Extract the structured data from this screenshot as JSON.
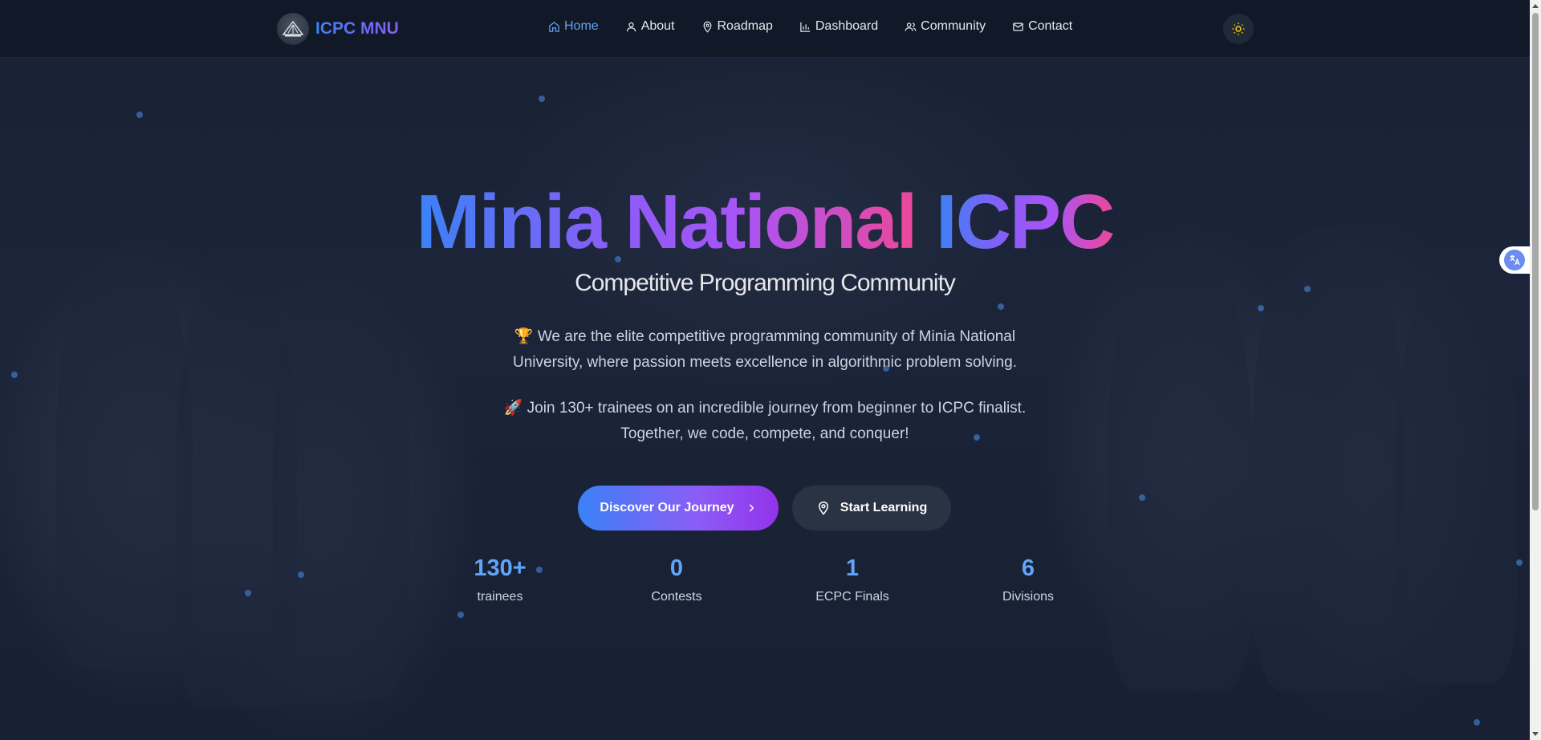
{
  "header": {
    "brand": "ICPC MNU",
    "nav": [
      {
        "label": "Home",
        "icon": "home-icon",
        "active": true
      },
      {
        "label": "About",
        "icon": "user-icon",
        "active": false
      },
      {
        "label": "Roadmap",
        "icon": "map-pin-icon",
        "active": false
      },
      {
        "label": "Dashboard",
        "icon": "bar-chart-icon",
        "active": false
      },
      {
        "label": "Community",
        "icon": "users-icon",
        "active": false
      },
      {
        "label": "Contact",
        "icon": "mail-icon",
        "active": false
      }
    ],
    "theme_toggle_icon": "sun-icon"
  },
  "hero": {
    "title_part1": "Minia National",
    "title_part2": "ICPC",
    "subtitle": "Competitive Programming Community",
    "paragraph1": "🏆 We are the elite competitive programming community of Minia National University, where passion meets excellence in algorithmic problem solving.",
    "paragraph2": "🚀 Join 130+ trainees on an incredible journey from beginner to ICPC finalist. Together, we code, compete, and conquer!",
    "primary_button": "Discover Our Journey",
    "secondary_button": "Start Learning"
  },
  "stats": [
    {
      "value": "130+",
      "label": "trainees"
    },
    {
      "value": "0",
      "label": "Contests"
    },
    {
      "value": "1",
      "label": "ECPC Finals"
    },
    {
      "value": "6",
      "label": "Divisions"
    }
  ],
  "colors": {
    "accent_blue": "#3b82f6",
    "accent_purple": "#8b5cf6",
    "accent_pink": "#ec4899",
    "background": "#111827"
  }
}
